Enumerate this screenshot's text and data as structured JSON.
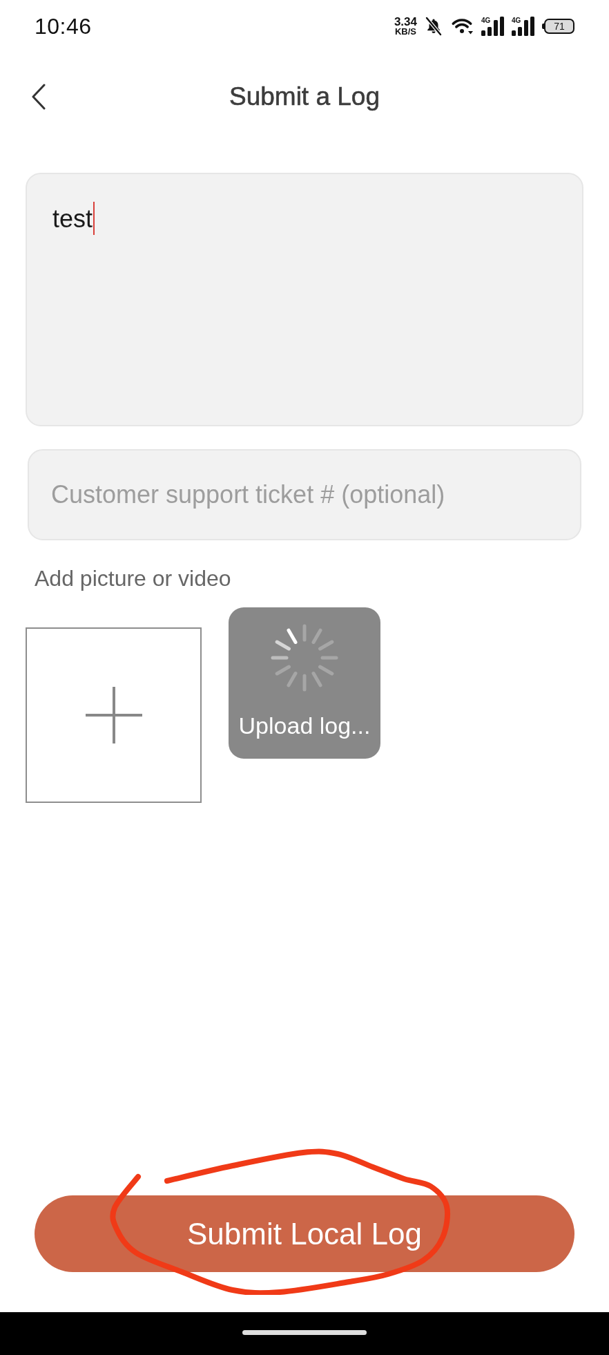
{
  "status_bar": {
    "time": "10:46",
    "net_speed": "3.34",
    "net_unit": "KB/S",
    "signals": [
      {
        "label": "4G"
      },
      {
        "label": "4G"
      }
    ],
    "battery": "71"
  },
  "header": {
    "title": "Submit a Log"
  },
  "description": {
    "value": "test",
    "focused": true
  },
  "ticket": {
    "placeholder": "Customer support ticket # (optional)"
  },
  "attachments": {
    "label": "Add picture or video",
    "items": [
      {
        "kind": "add"
      },
      {
        "kind": "uploading",
        "label": "Upload log..."
      }
    ]
  },
  "submit_button": {
    "label": "Submit Local Log",
    "circled": true
  }
}
